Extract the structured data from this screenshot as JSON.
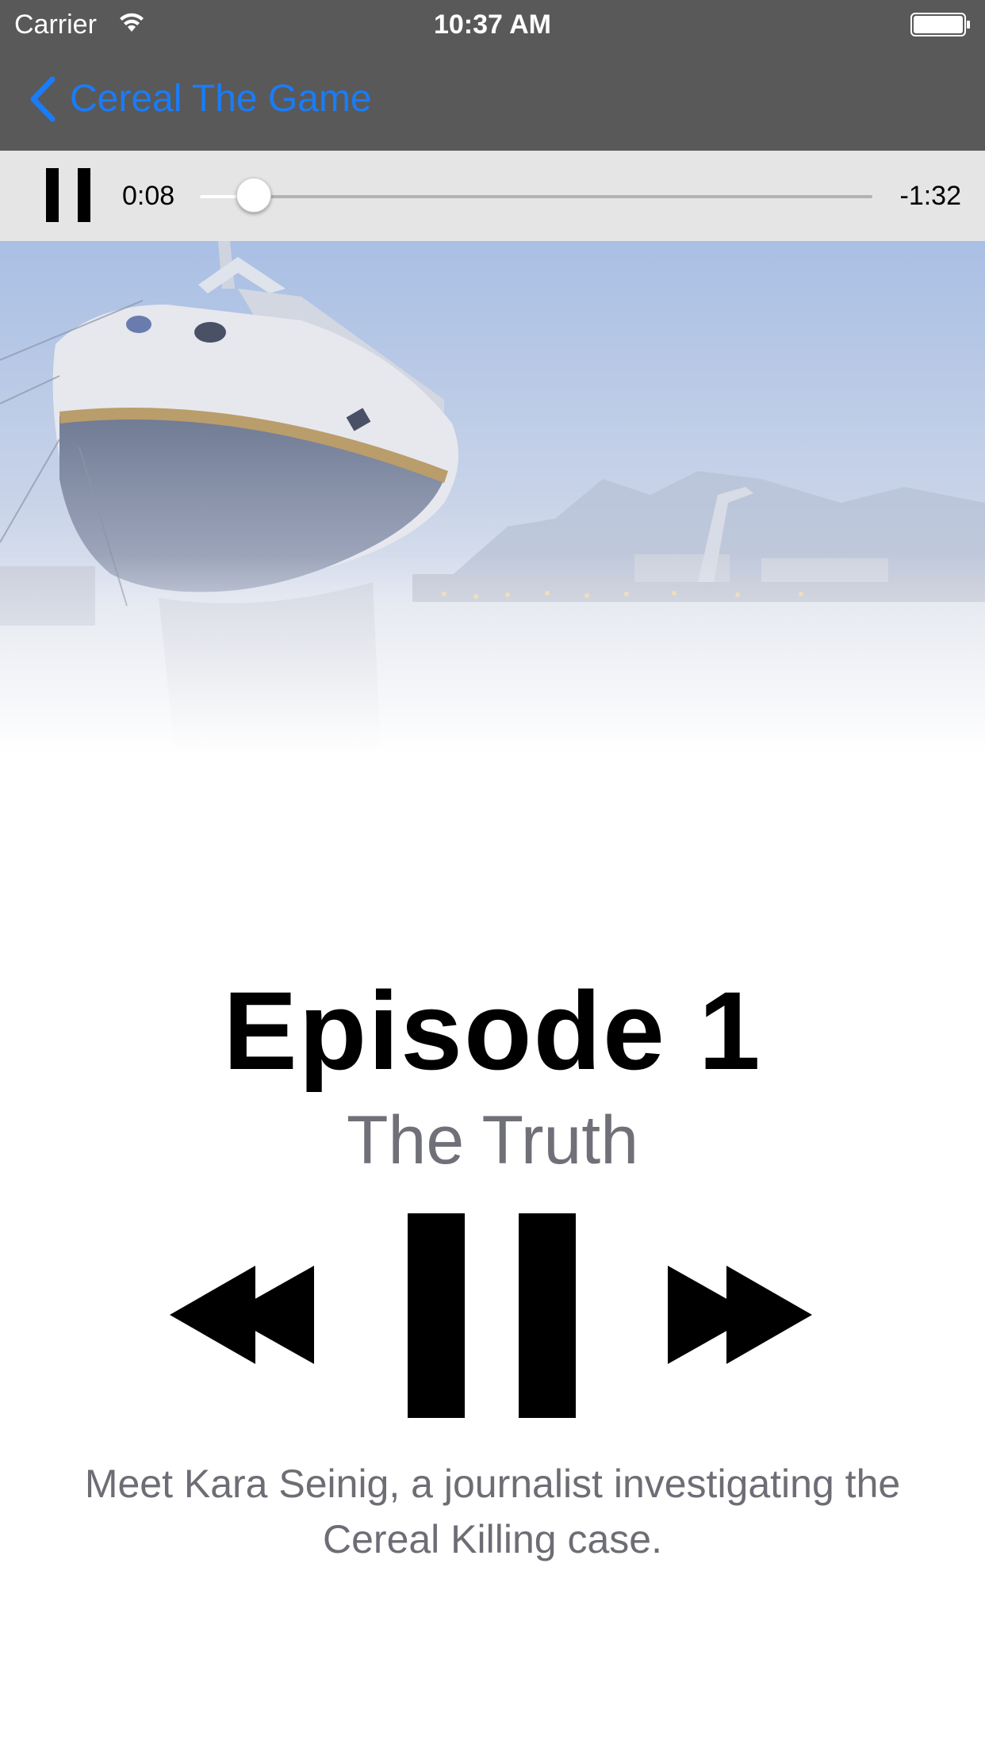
{
  "status_bar": {
    "carrier": "Carrier",
    "time": "10:37 AM",
    "wifi_icon": "wifi-icon",
    "battery_icon": "battery-icon"
  },
  "nav": {
    "back_label": "Cereal The Game",
    "back_icon": "chevron-left-icon",
    "accent_color": "#1a7cf7"
  },
  "player": {
    "elapsed": "0:08",
    "remaining": "-1:32",
    "progress_fraction": 0.08,
    "state": "playing",
    "mini_pause_icon": "pause-icon"
  },
  "hero": {
    "image_subject": "ship in harbour at dusk"
  },
  "episode": {
    "title": "Episode 1",
    "subtitle": "The Truth",
    "description": "Meet Kara Seinig, a journalist investigating the Cereal Killing case."
  },
  "controls": {
    "rewind_icon": "rewind-icon",
    "pause_icon": "pause-icon",
    "forward_icon": "fast-forward-icon"
  }
}
